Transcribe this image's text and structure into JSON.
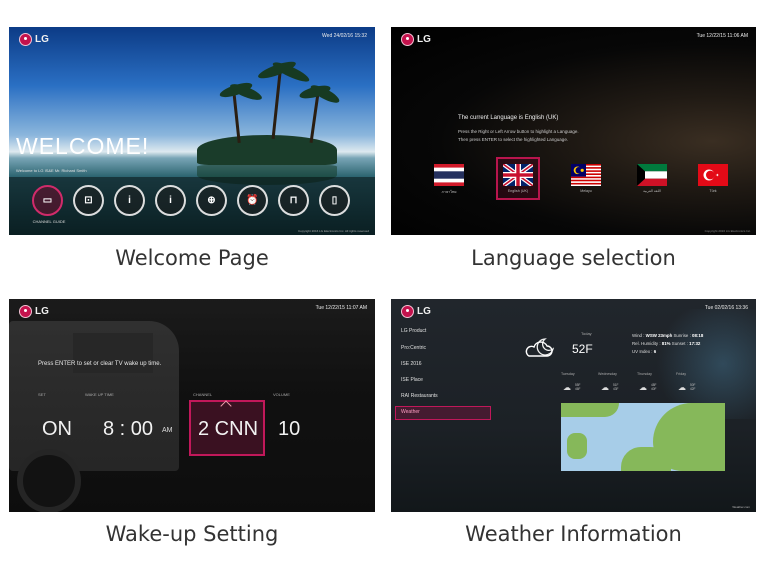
{
  "panels": {
    "welcome": {
      "caption": "Welcome Page",
      "clock": "Wed 24/02/16 15:32",
      "logo": {
        "brand": "LG",
        "sub": "sofa in a lab"
      },
      "heading": "WELCOME!",
      "message": "Welcome to LG IS&E Mr. Richard Smith",
      "menu": [
        {
          "icon": "tv-icon",
          "glyph": "▭"
        },
        {
          "icon": "gift-icon",
          "glyph": "⊡"
        },
        {
          "icon": "info-icon",
          "glyph": "i"
        },
        {
          "icon": "info-icon-2",
          "glyph": "i"
        },
        {
          "icon": "globe-icon",
          "glyph": "⊕"
        },
        {
          "icon": "alarm-clock-icon",
          "glyph": "⏰"
        },
        {
          "icon": "bag-icon",
          "glyph": "⊓"
        },
        {
          "icon": "mobile-icon",
          "glyph": "▯"
        }
      ],
      "active_label": "CHANNEL GUIDE",
      "footer": "Copyright 2016 LG Electronics Inc. All rights reserved"
    },
    "language": {
      "caption": "Language selection",
      "clock": "Tue 12/22/15 11:06 AM",
      "current": "The current Language is English (UK)",
      "instr1": "Press the Right or Left Arrow button to highlight a Language.",
      "instr2": "Then press ENTER to select the highlighted Language.",
      "languages": [
        {
          "label": "ภาษาไทย",
          "flag": "thailand-flag"
        },
        {
          "label": "English (UK)",
          "flag": "uk-flag"
        },
        {
          "label": "Melayu",
          "flag": "malaysia-flag"
        },
        {
          "label": "اللغة العربية",
          "flag": "kuwait-flag"
        },
        {
          "label": "Türk",
          "flag": "turkey-flag"
        }
      ],
      "footer": "Copyright 2016 LG Electronics Inc."
    },
    "wakeup": {
      "caption": "Wake-up Setting",
      "clock": "Tue 12/22/15 11:07 AM",
      "instruction": "Press ENTER to set or clear TV wake up time.",
      "headers": {
        "set": "SET",
        "time": "WAKE UP TIME",
        "channel": "CHANNEL",
        "volume": "VOLUME"
      },
      "values": {
        "set": "ON",
        "time": "8 : 00",
        "ampm": "AM",
        "channel": "2 CNN",
        "volume": "10"
      }
    },
    "weather": {
      "caption": "Weather Information",
      "clock": "Tue 02/02/16 13:36",
      "sidebar": [
        "LG Product",
        "Pro:Centric",
        "ISE 2016",
        "ISE Place",
        "RAI Restaurants",
        "Weather"
      ],
      "today_label": "Today",
      "temperature": "52F",
      "stats": [
        {
          "k": "Wind : ",
          "v": "WSW 23mph",
          "k2": "  Sunrise : ",
          "v2": "08:18"
        },
        {
          "k": "Rel. Humidity : ",
          "v": "81%",
          "k2": "  Sunset : ",
          "v2": "17:32"
        },
        {
          "k": "UV Index : ",
          "v": "6",
          "k2": "",
          "v2": ""
        }
      ],
      "forecast": [
        {
          "day": "Tuesday",
          "hi": "55F",
          "lo": "46F"
        },
        {
          "day": "Wednesday",
          "hi": "51F",
          "lo": "43F"
        },
        {
          "day": "Thursday",
          "hi": "48F",
          "lo": "40F"
        },
        {
          "day": "Friday",
          "hi": "50F",
          "lo": "42F"
        }
      ],
      "footer": "Weather.com"
    }
  },
  "colors": {
    "accent": "#c1185a",
    "text_caption": "#333333"
  }
}
